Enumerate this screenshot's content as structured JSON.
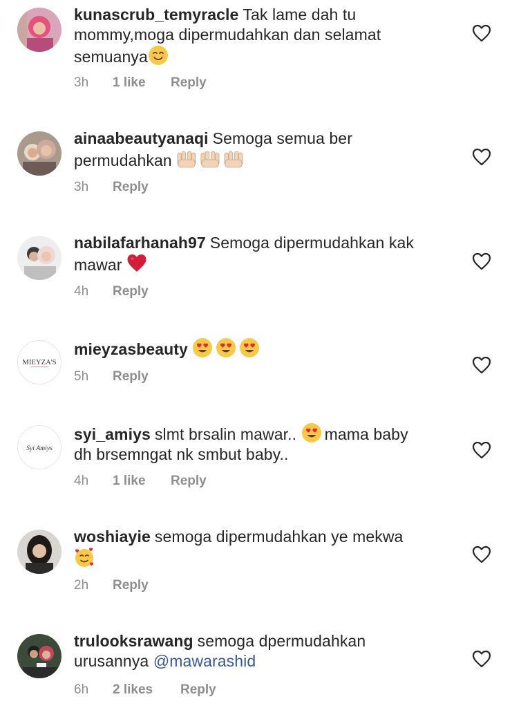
{
  "colors": {
    "text": "#262626",
    "meta": "#8e8e8e",
    "mention": "#385898"
  },
  "comments": [
    {
      "user": "kunascrub_temyracle",
      "line1": "Tak lame dah tu",
      "line2": "mommy,moga  dipermudahkan dan selamat",
      "line3": "semuanya",
      "emoji": "smiling-face",
      "time": "3h",
      "likes": "1 like",
      "reply": "Reply"
    },
    {
      "user": "ainaabeautyanaqi",
      "line1": "Semoga semua ber",
      "line2": "permudahkan",
      "emoji": "raised-hands",
      "time": "3h",
      "reply": "Reply"
    },
    {
      "user": "nabilafarhanah97",
      "line1": "Semoga dipermudahkan kak",
      "line2": "mawar",
      "emoji": "red-heart",
      "time": "4h",
      "reply": "Reply"
    },
    {
      "user": "mieyzasbeauty",
      "emoji": "heart-eyes",
      "time": "5h",
      "reply": "Reply",
      "avatar_text": "MIEYZA'S"
    },
    {
      "user": "syi_amiys",
      "line1": "slmt brsalin mawar..",
      "line1b": "mama baby",
      "line2": "dh brsemngat nk smbut baby..",
      "emoji": "heart-eyes",
      "time": "4h",
      "likes": "1 like",
      "reply": "Reply",
      "avatar_text": "Syi Amiys"
    },
    {
      "user": "woshiayie",
      "line1": "semoga dipermudahkan ye mekwa",
      "emoji": "smiling-hearts",
      "time": "2h",
      "reply": "Reply"
    },
    {
      "user": "trulooksrawang",
      "line1": "semoga dpermudahkan",
      "line2": "urusannya",
      "mention": "@mawarashid",
      "time": "6h",
      "likes": "2 likes",
      "reply": "Reply"
    }
  ]
}
